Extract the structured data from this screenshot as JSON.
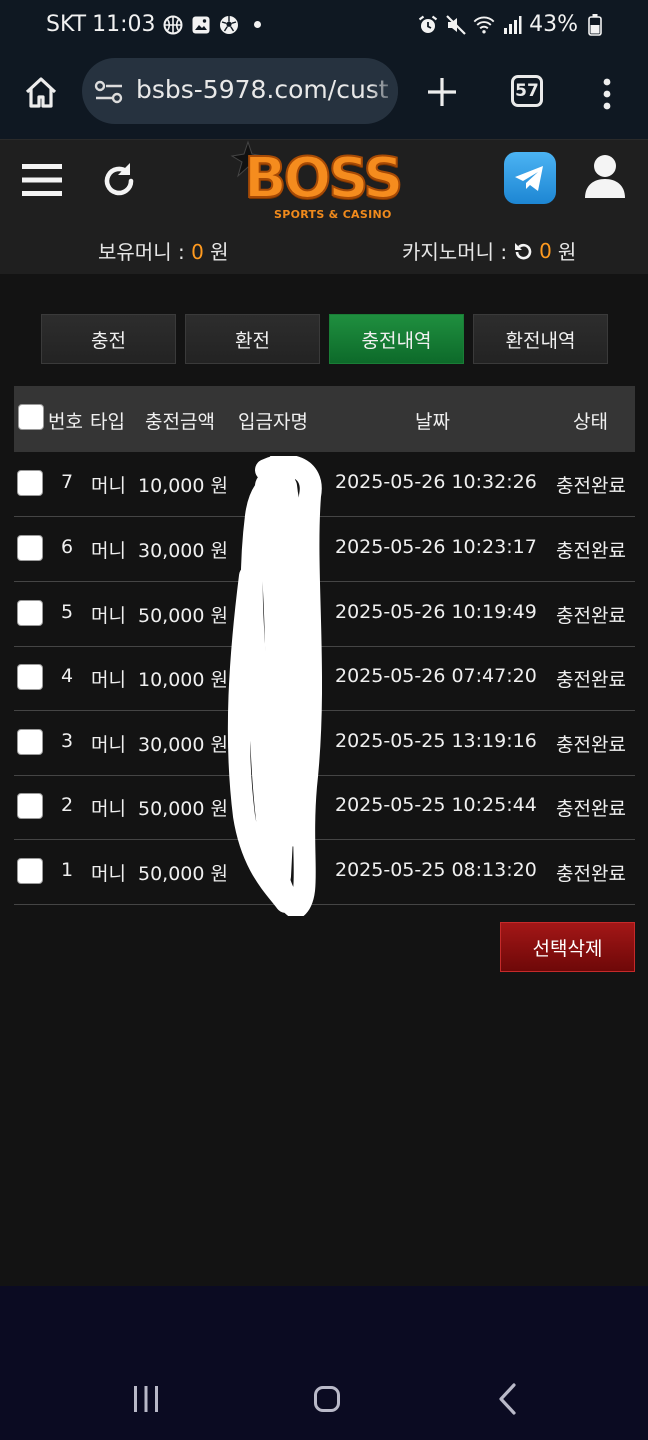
{
  "status": {
    "carrier": "SKT",
    "time": "11:03",
    "battery": "43%"
  },
  "browser": {
    "url": "bsbs-5978.com/cust",
    "tab_count": "57"
  },
  "header": {
    "logo_main": "BOSS",
    "logo_sub": "SPORTS & CASINO",
    "balance_label": "보유머니 :",
    "balance_value": "0",
    "casino_label": "카지노머니 :",
    "casino_value": "0",
    "currency": "원"
  },
  "tabs": [
    {
      "label": "충전"
    },
    {
      "label": "환전"
    },
    {
      "label": "충전내역",
      "active": true
    },
    {
      "label": "환전내역"
    }
  ],
  "table": {
    "columns": [
      "번호",
      "타입",
      "충전금액",
      "입금자명",
      "날짜",
      "상태"
    ],
    "rows": [
      {
        "no": "7",
        "type": "머니",
        "amount": "10,000 원",
        "date": "2025-05-26 10:32:26",
        "status": "충전완료"
      },
      {
        "no": "6",
        "type": "머니",
        "amount": "30,000 원",
        "date": "2025-05-26 10:23:17",
        "status": "충전완료"
      },
      {
        "no": "5",
        "type": "머니",
        "amount": "50,000 원",
        "date": "2025-05-26 10:19:49",
        "status": "충전완료"
      },
      {
        "no": "4",
        "type": "머니",
        "amount": "10,000 원",
        "date": "2025-05-26 07:47:20",
        "status": "충전완료"
      },
      {
        "no": "3",
        "type": "머니",
        "amount": "30,000 원",
        "date": "2025-05-25 13:19:16",
        "status": "충전완료"
      },
      {
        "no": "2",
        "type": "머니",
        "amount": "50,000 원",
        "date": "2025-05-25 10:25:44",
        "status": "충전완료"
      },
      {
        "no": "1",
        "type": "머니",
        "amount": "50,000 원",
        "date": "2025-05-25 08:13:20",
        "status": "충전완료"
      }
    ]
  },
  "actions": {
    "delete_selected": "선택삭제"
  },
  "icons": {
    "status_left": [
      "basketball-icon",
      "image-icon",
      "soccer-icon"
    ],
    "status_right": [
      "alarm-icon",
      "mute-icon",
      "wifi-icon",
      "signal-icon",
      "battery-icon"
    ],
    "header": [
      "menu-icon",
      "refresh-icon",
      "telegram-icon",
      "user-icon"
    ]
  },
  "colors": {
    "accent_orange": "#ff9a1f",
    "active_tab_green": "#1f8f3f",
    "delete_red": "#a31717"
  }
}
